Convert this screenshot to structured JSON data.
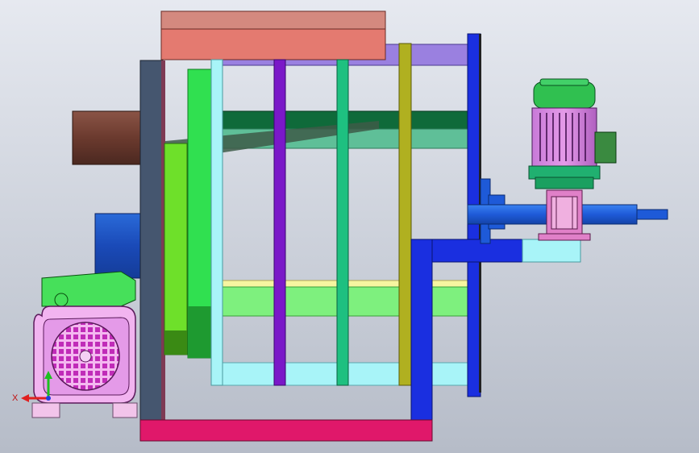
{
  "viewer": {
    "title": "",
    "triad": {
      "x_label": "X",
      "y_label": ""
    }
  },
  "colors": {
    "top_block": "#e47a70",
    "frame_left": "#45566f",
    "base_rail": "#e0186a",
    "purple_top_bar": "#9a80e0",
    "right_blue": "#1a2fe0",
    "motor_green": "#39e06a",
    "gearbox_pink": "#e080c8",
    "shaft_blue": "#1e5ad8",
    "cyan_plate": "#a8f4f8",
    "brown_cylinder": "#6b3a2e",
    "lime_plate": "#6ee86e",
    "light_yellow": "#f6f5a0"
  },
  "parts": [
    "top-block",
    "left-frame-post",
    "brown-cylinder",
    "blue-bearing",
    "green-disk",
    "lime-disk",
    "vertical-bars",
    "horizontal-plates",
    "right-blue-plate",
    "motor-right",
    "gearbox-right",
    "drive-shaft",
    "base-rail",
    "motor-left"
  ]
}
